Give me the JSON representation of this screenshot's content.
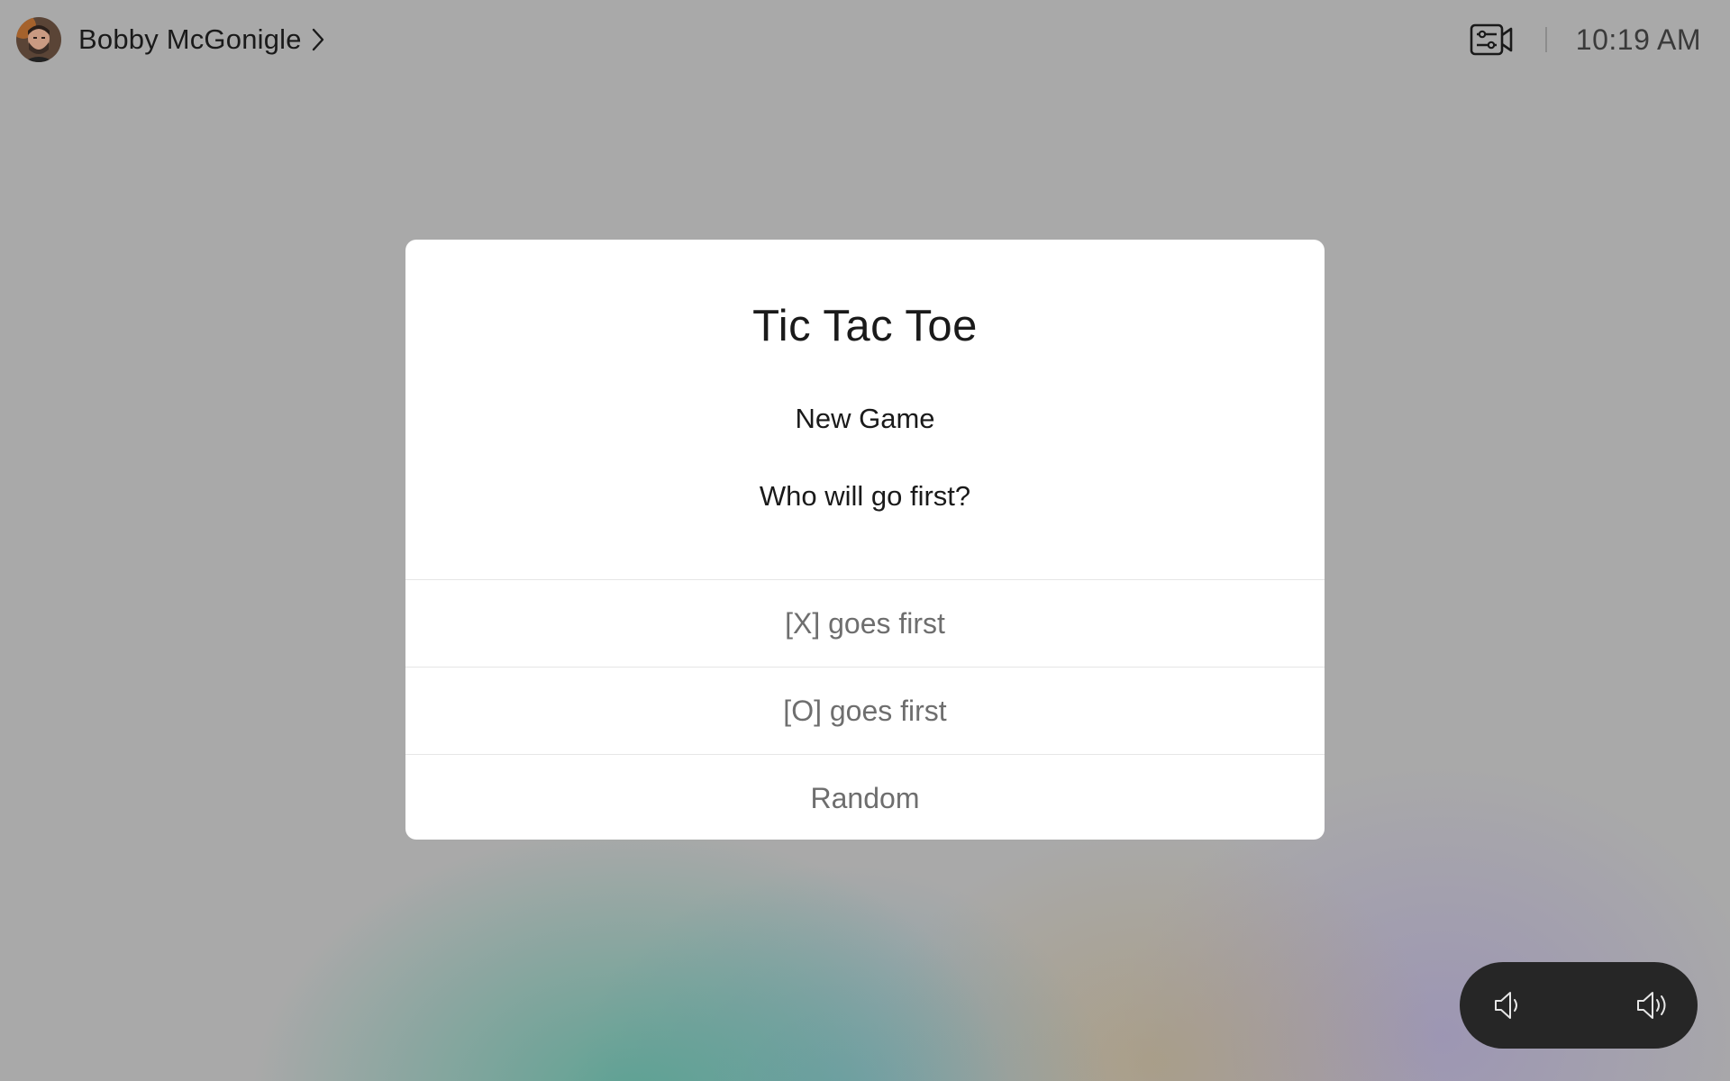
{
  "header": {
    "user_name": "Bobby McGonigle",
    "time": "10:19 AM",
    "icons": {
      "avatar": "user-avatar",
      "chevron": "chevron-right-icon",
      "camera_settings": "camera-settings-icon"
    }
  },
  "dialog": {
    "title": "Tic Tac Toe",
    "subtitle": "New Game",
    "question": "Who will go first?",
    "options": [
      {
        "label": "[X] goes first"
      },
      {
        "label": "[O] goes first"
      },
      {
        "label": "Random"
      }
    ]
  },
  "volume": {
    "icons": {
      "down": "volume-down-icon",
      "up": "volume-up-icon"
    }
  },
  "colors": {
    "background": "#a9a9a9",
    "dialog_bg": "#ffffff",
    "option_text": "#6e6e6e",
    "volume_bg": "#262626"
  }
}
